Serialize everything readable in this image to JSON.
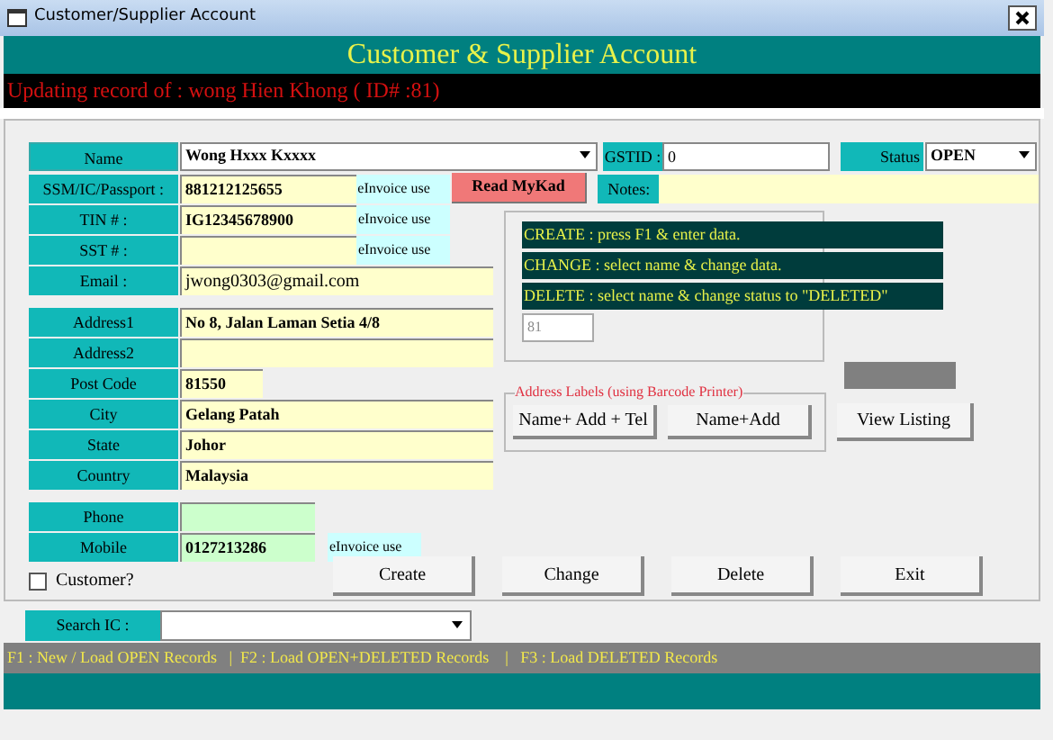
{
  "window": {
    "title": "Customer/Supplier Account"
  },
  "header": "Customer & Supplier Account",
  "record_banner": "Updating record of : wong Hien Khong ( ID# :81)",
  "name": {
    "label": "Name",
    "value": "Wong Hxxx Kxxxx"
  },
  "gstid": {
    "label": "GSTID :",
    "value": "0"
  },
  "status": {
    "label": "Status",
    "value": "OPEN"
  },
  "ssm": {
    "label": "SSM/IC/Passport :",
    "value": "881212125655",
    "note": "eInvoice use"
  },
  "read_mykad": "Read MyKad",
  "notes": {
    "label": "Notes:"
  },
  "field_groups": [
    [
      {
        "kind": "id",
        "label": "TIN # :",
        "value": "IG12345678900",
        "note": "eInvoice use"
      },
      {
        "kind": "id",
        "label": "SST # :",
        "note": "eInvoice use"
      },
      {
        "kind": "email",
        "label": "Email :",
        "value": "jwong0303@gmail.com"
      }
    ],
    [
      {
        "kind": "long",
        "label": "Address1",
        "value": "No 8, Jalan Laman Setia 4/8"
      },
      {
        "kind": "long",
        "label": "Address2"
      },
      {
        "kind": "short",
        "label": "Post Code",
        "value": "81550"
      },
      {
        "kind": "long",
        "label": "City",
        "value": "Gelang Patah"
      },
      {
        "kind": "long",
        "label": "State",
        "value": "Johor"
      },
      {
        "kind": "long",
        "label": "Country",
        "value": "Malaysia"
      }
    ],
    [
      {
        "kind": "phone",
        "label": "Phone"
      },
      {
        "kind": "phone",
        "label": "Mobile",
        "value": "0127213286",
        "note": "eInvoice use"
      }
    ]
  ],
  "help_lines": [
    "CREATE : press F1 & enter data.",
    "CHANGE : select name & change data.",
    "DELETE : select name & change status to \"DELETED\""
  ],
  "record_id": "81",
  "address_labels": {
    "title": "Address Labels (using Barcode Printer)",
    "buttons": [
      "Name+ Add + Tel",
      "Name+Add"
    ]
  },
  "view_listing": "View Listing",
  "customer": {
    "label": "Customer?",
    "checked": false
  },
  "actions": [
    "Create",
    "Change",
    "Delete",
    "Exit"
  ],
  "search": {
    "label": "Search IC :"
  },
  "shortcuts": "F1 : New / Load OPEN Records   |  F2 : Load OPEN+DELETED Records    |   F3 : Load DELETED Records"
}
